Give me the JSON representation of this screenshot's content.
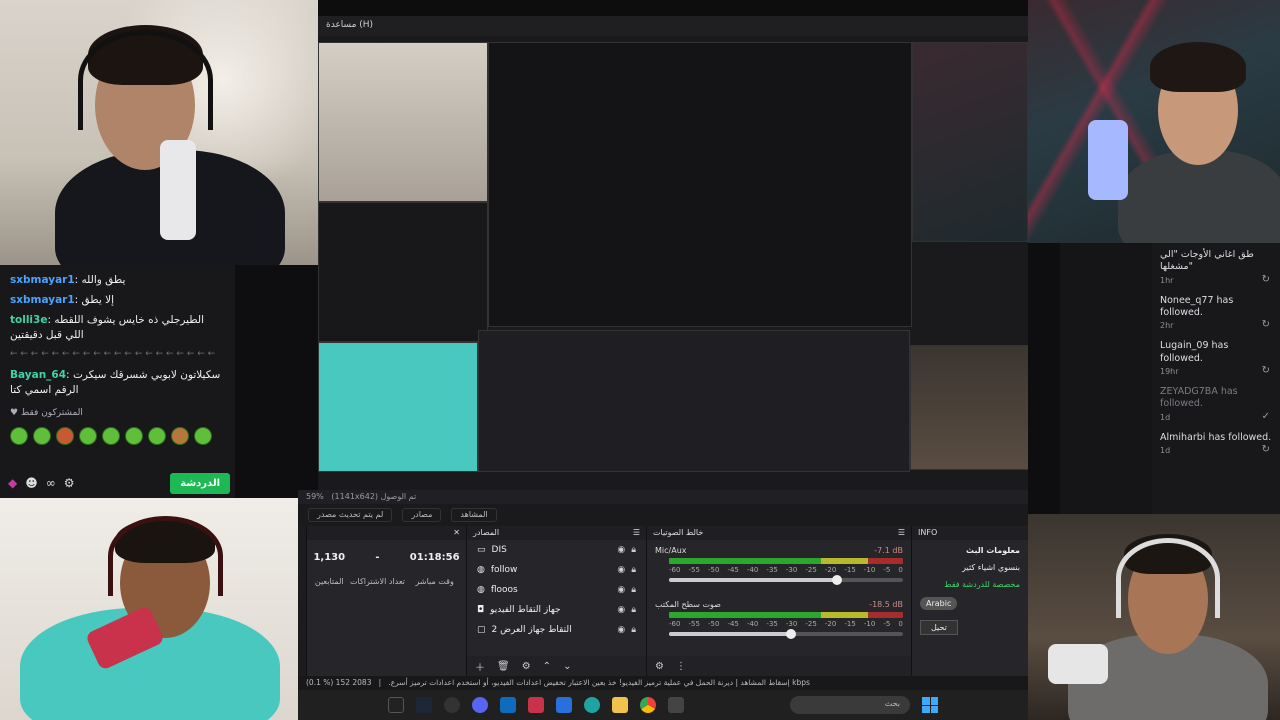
{
  "nested": {
    "menu_label": "مساعدة (H)"
  },
  "chat": {
    "messages": [
      {
        "user": "sxbmayar1",
        "color": "blue",
        "text": "يطق والله"
      },
      {
        "user": "sxbmayar1",
        "color": "blue",
        "text": "إلا يطق"
      },
      {
        "user": "tolli3e",
        "color": "green",
        "text": "الطيرجلي ذه خايس يشوف اللقطه اللي قبل دقيقتين"
      },
      {
        "user": "Bayan_64",
        "color": "green",
        "text": "سكيلاتون لابوبي شسرقك سيكرت الرقم اسمي كتا"
      }
    ],
    "sub_only": "المشتركون فقط",
    "send_label": "الدردشة"
  },
  "feed": {
    "items": [
      {
        "text": "طق اغاني الأوجات \"الي مشغلها\"",
        "time": "1hr",
        "muted": false,
        "action": "↻"
      },
      {
        "text": "Nonee_q77 has followed.",
        "time": "2hr",
        "muted": false,
        "action": "↻"
      },
      {
        "text": "Lugain_09 has followed.",
        "time": "19hr",
        "muted": false,
        "action": "↻"
      },
      {
        "text": "ZEYADG7BA has followed.",
        "time": "1d",
        "muted": true,
        "action": "✓"
      },
      {
        "text": "Almiharbi has followed.",
        "time": "1d",
        "muted": false,
        "action": "↻"
      }
    ]
  },
  "obs": {
    "zoom": "59%",
    "resolution": "(1141x642) تم الوصول",
    "tabs": [
      "لم يتم تحديث مصدر",
      "مصادر",
      "المشاهد"
    ],
    "stats": {
      "title": "",
      "followers": {
        "value": "1,130",
        "label": "المتابعين"
      },
      "subs": {
        "value": "-",
        "label": "تعداد الاشتراكات"
      },
      "time": {
        "value": "01:18:56",
        "label": "وقت مباشر"
      }
    },
    "sources": {
      "title": "المصادر",
      "items": [
        {
          "name": "DIS",
          "icon": "monitor-icon"
        },
        {
          "name": "follow",
          "icon": "globe-icon"
        },
        {
          "name": "flooos",
          "icon": "globe-icon"
        },
        {
          "name": "جهاز التقاط الفيديو",
          "icon": "camera-icon"
        },
        {
          "name": "التقاط جهاز العرض 2",
          "icon": "display-icon"
        }
      ]
    },
    "mixer": {
      "title": "خالط الصوتيات",
      "tracks": [
        {
          "name": "Mic/Aux",
          "db": "-7.1 dB",
          "level": 0.72
        },
        {
          "name": "صوت سطح المكتب",
          "db": "-18.5 dB",
          "level": 0.52
        }
      ],
      "scale": [
        "-60",
        "-55",
        "-50",
        "-45",
        "-40",
        "-35",
        "-30",
        "-25",
        "-20",
        "-15",
        "-10",
        "-5",
        "0"
      ]
    },
    "info": {
      "title": "INFO",
      "heading": "معلومات البث",
      "stream_title": "بنسوي اشياء كثير",
      "category": "مخصصة للدردشة فقط",
      "language": "Arabic",
      "edit_label": "تحيل"
    },
    "status": "(0.1 %) 152 إسقاط المشاهد  |  ديرنة الحمل في عملية ترميز الفيديو! خذ بعين الاعتبار تخفيض اعدادات الفيديو، أو استخدم اعدادات ترميز أسرع.",
    "bitrate": "2083 kbps",
    "search_placeholder": "بحث"
  },
  "colors": {
    "accent": "#1db954",
    "twitch_bg": "#18181b"
  }
}
